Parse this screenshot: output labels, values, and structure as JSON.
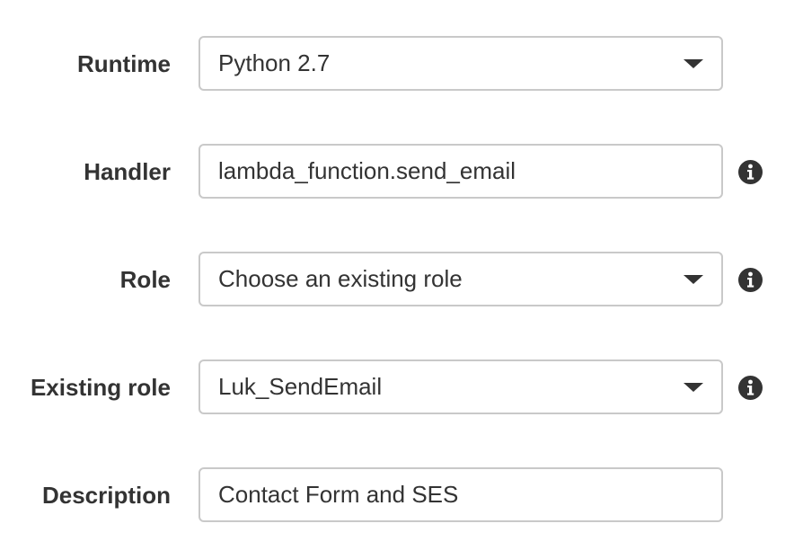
{
  "form": {
    "runtime": {
      "label": "Runtime",
      "value": "Python 2.7"
    },
    "handler": {
      "label": "Handler",
      "value": "lambda_function.send_email",
      "info_icon": "info-circle-icon"
    },
    "role": {
      "label": "Role",
      "value": "Choose an existing role",
      "info_icon": "info-circle-icon"
    },
    "existing_role": {
      "label": "Existing role",
      "value": "Luk_SendEmail",
      "info_icon": "info-circle-icon"
    },
    "description": {
      "label": "Description",
      "value": "Contact Form and SES"
    }
  },
  "colors": {
    "label_text": "#333333",
    "border": "#c9c9c9",
    "icon": "#333333"
  }
}
